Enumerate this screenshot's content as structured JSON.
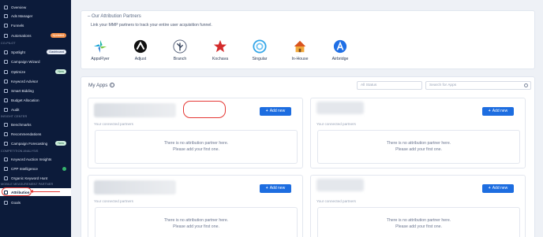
{
  "sidebar": {
    "items": [
      {
        "label": "Overview"
      },
      {
        "label": "Ads Manager"
      },
      {
        "label": "Funnels"
      },
      {
        "label": "Automations",
        "badge": "Updated"
      },
      {
        "label": "Spotlight",
        "badge": "Dashboard"
      },
      {
        "label": "Campaign Wizard"
      },
      {
        "label": "Optimize",
        "badge": "New"
      },
      {
        "label": "Keyword Advisor"
      },
      {
        "label": "Smart Bidding"
      },
      {
        "label": "Budget Allocation"
      },
      {
        "label": "Audit"
      },
      {
        "label": "Benchmarks"
      },
      {
        "label": "Recommendations"
      },
      {
        "label": "Campaign Forecasting",
        "badge": "New"
      },
      {
        "label": "Keyword Auction Insights"
      },
      {
        "label": "CPP Intelligence"
      },
      {
        "label": "Organic Keyword Hunt"
      },
      {
        "label": "Attribution"
      },
      {
        "label": "Goals"
      }
    ],
    "sections": {
      "copilot": "CO-PILOT",
      "insight": "INSIGHT CENTER",
      "competition": "COMPETITION ANALYSIS",
      "mobile": "MOBILE MEASUREMENT PARTNER"
    }
  },
  "partners": {
    "title": "Our Attribution Partners",
    "subtitle": "Link your MMP partners to track your entire user acquisition funnel.",
    "list": [
      {
        "name": "AppsFlyer",
        "icon": "appsflyer-icon"
      },
      {
        "name": "Adjust",
        "icon": "adjust-icon"
      },
      {
        "name": "Branch",
        "icon": "branch-icon"
      },
      {
        "name": "Kochava",
        "icon": "kochava-icon"
      },
      {
        "name": "Singular",
        "icon": "singular-icon"
      },
      {
        "name": "In-House",
        "icon": "house-icon"
      },
      {
        "name": "Airbridge",
        "icon": "airbridge-icon"
      }
    ]
  },
  "apps": {
    "title": "My Apps",
    "status_placeholder": "All Status",
    "search_placeholder": "Search for Apps",
    "add_label": "Add new",
    "connected_label": "Your connected partners",
    "empty_line1": "There is no attribution partner here.",
    "empty_line2": "Please add your first one."
  },
  "colors": {
    "sidebar_bg": "#0c1b3a",
    "accent": "#1d6de0",
    "highlight": "#e53935"
  }
}
